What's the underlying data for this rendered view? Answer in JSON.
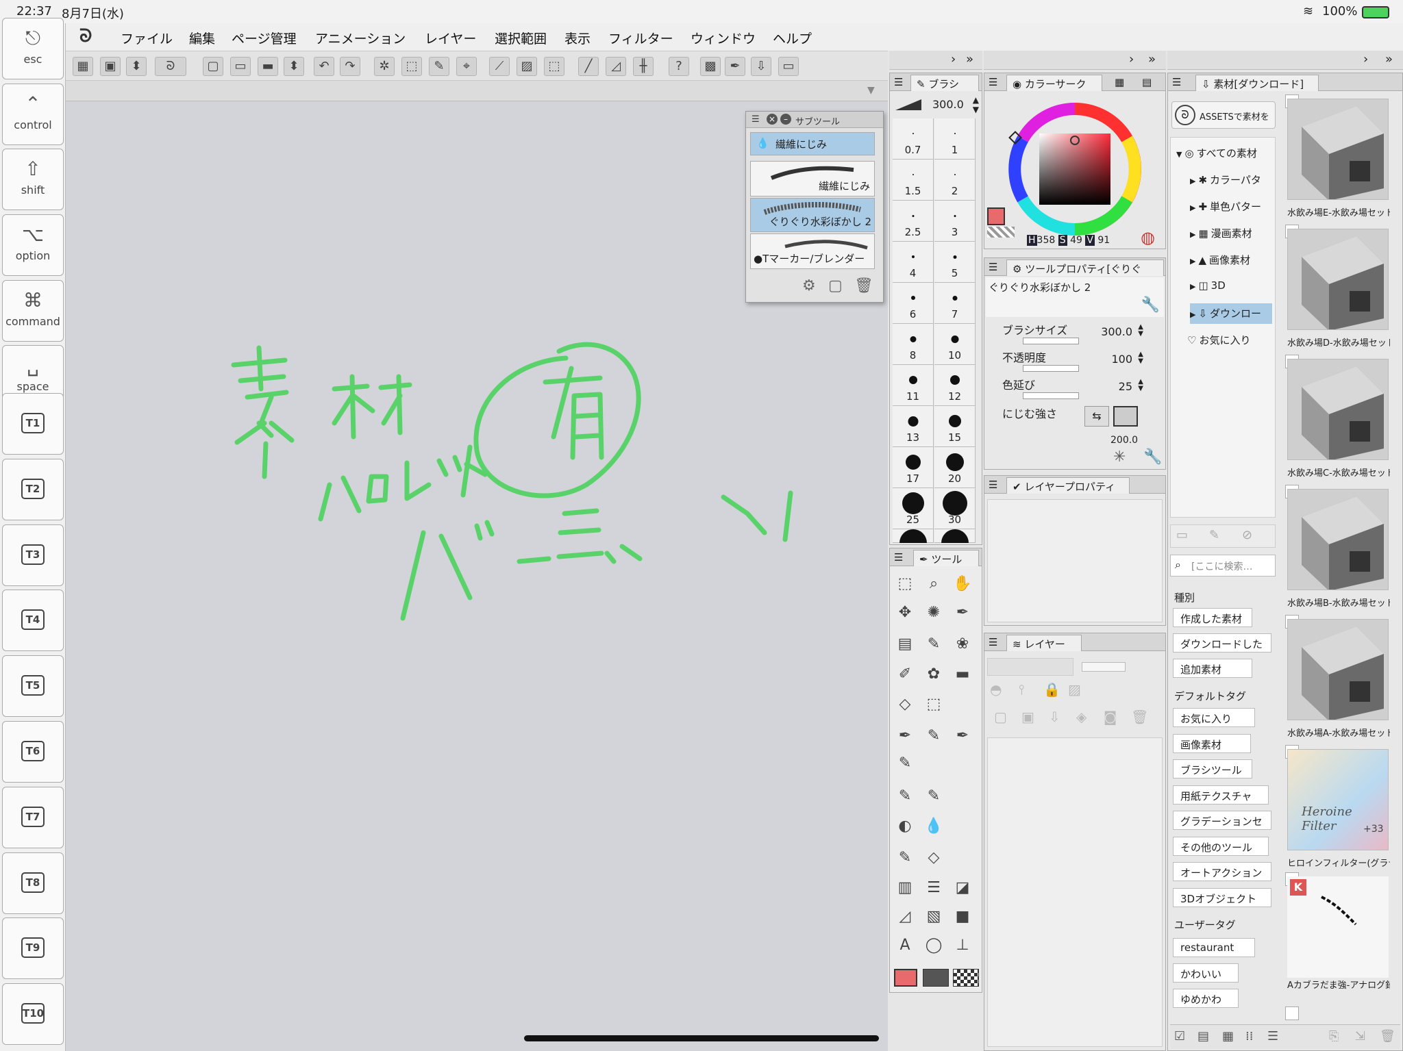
{
  "status": {
    "time": "22:37",
    "date": "8月7日(水)",
    "battery": "100%"
  },
  "left_keys": [
    {
      "icon": "⎋",
      "label": "esc"
    },
    {
      "icon": "⌃",
      "label": "control"
    },
    {
      "icon": "⇧",
      "label": "shift"
    },
    {
      "icon": "⌥",
      "label": "option"
    },
    {
      "icon": "⌘",
      "label": "command"
    },
    {
      "icon": "␣",
      "label": "space"
    }
  ],
  "t_keys": [
    "T1",
    "T2",
    "T3",
    "T4",
    "T5",
    "T6",
    "T7",
    "T8",
    "T9",
    "T10"
  ],
  "menu": [
    "ファイル",
    "編集",
    "ページ管理",
    "アニメーション",
    "レイヤー",
    "選択範囲",
    "表示",
    "フィルター",
    "ウィンドウ",
    "ヘルプ"
  ],
  "subtool": {
    "title": "サブツール",
    "selected": "繊維にじみ",
    "items": [
      "繊維にじみ",
      "ぐりぐり水彩ぼかし 2",
      "●Tマーカー/ブレンダー"
    ]
  },
  "brush": {
    "tab": "ブラシ",
    "size": "300.0",
    "sizes": [
      "0.7",
      "1",
      "1.5",
      "2",
      "2.5",
      "3",
      "4",
      "5",
      "6",
      "7",
      "8",
      "10",
      "11",
      "12",
      "13",
      "15",
      "17",
      "20",
      "25",
      "30"
    ]
  },
  "color": {
    "tab": "カラーサーク",
    "main": "#e96a6c",
    "h": "358",
    "s": "49",
    "v": "91",
    "h_label": "H",
    "s_label": "S",
    "v_label": "V"
  },
  "toolprop": {
    "tab": "ツールプロパティ[ぐりぐ",
    "name": "ぐりぐり水彩ぼかし 2",
    "rows": [
      {
        "label": "ブラシサイズ",
        "value": "300.0"
      },
      {
        "label": "不透明度",
        "value": "100"
      },
      {
        "label": "色延び",
        "value": "25"
      },
      {
        "label": "にじむ強さ",
        "value": ""
      }
    ],
    "extra": "200.0"
  },
  "layerprop": {
    "tab": "レイヤープロパティ"
  },
  "layer": {
    "tab": "レイヤー"
  },
  "tool": {
    "tab": "ツール"
  },
  "assets": {
    "tab": "素材[ダウンロード]",
    "assets_btn": "ASSETSで素材を",
    "tree": [
      "すべての素材",
      "カラーパタ",
      "単色パター",
      "漫画素材",
      "画像素材",
      "3D",
      "ダウンロー",
      "お気に入り"
    ],
    "search_placeholder": "[ここに検索…",
    "kind_label": "種別",
    "kinds": [
      "作成した素材",
      "ダウンロードした",
      "追加素材"
    ],
    "default_tags_label": "デフォルトタグ",
    "default_tags": [
      "お気に入り",
      "画像素材",
      "ブラシツール",
      "用紙テクスチャ",
      "グラデーションセ",
      "その他のツール",
      "オートアクション",
      "3Dオブジェクト"
    ],
    "user_tags_label": "ユーザータグ",
    "user_tags": [
      "restaurant",
      "かわいい",
      "ゆめかわ"
    ],
    "items": [
      {
        "caption": "水飲み場E-水飲み場セット"
      },
      {
        "caption": "水飲み場D-水飲み場セット"
      },
      {
        "caption": "水飲み場C-水飲み場セット"
      },
      {
        "caption": "水飲み場B-水飲み場セット"
      },
      {
        "caption": "水飲み場A-水飲み場セット"
      },
      {
        "caption": "ヒロインフィルター(グラデ"
      },
      {
        "caption": "Aカブラだま強-アナログ鉛"
      }
    ],
    "thumb_text": "Heroine Filter",
    "thumb_sub": "+33"
  },
  "colors": {
    "stroke_green": "#5ad26a",
    "panel_bg": "#e8e8e8",
    "canvas_bg": "#d2d4d9",
    "selected": "#a9cbe6"
  }
}
